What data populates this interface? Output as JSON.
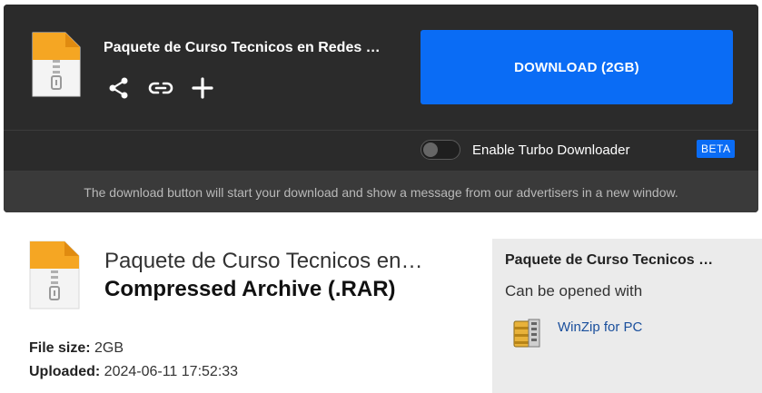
{
  "header": {
    "file_title": "Paquete de Curso Tecnicos en Redes …",
    "download_label": "DOWNLOAD (2GB)",
    "actions": [
      {
        "icon": "share-icon"
      },
      {
        "icon": "link-icon"
      },
      {
        "icon": "plus-icon"
      }
    ]
  },
  "turbo": {
    "label": "Enable Turbo Downloader",
    "badge": "BETA",
    "enabled": false
  },
  "notice": "The download button will start your download and show a message from our advertisers in a new window.",
  "file_info": {
    "title": "Paquete de Curso Tecnicos en…",
    "type": "Compressed Archive (.RAR)",
    "size_label": "File size:",
    "size_value": "2GB",
    "uploaded_label": "Uploaded:",
    "uploaded_value": "2024-06-11 17:52:33"
  },
  "side": {
    "title": "Paquete de Curso Tecnicos …",
    "subtitle": "Can be opened with",
    "app_name": "WinZip for PC",
    "app_icon": "winzip-icon"
  },
  "colors": {
    "accent": "#0a6cf5",
    "dark_bg": "#2b2b2b",
    "notice_bg": "#3a3a3a",
    "side_bg": "#ebebeb",
    "link": "#1a4f9c"
  }
}
